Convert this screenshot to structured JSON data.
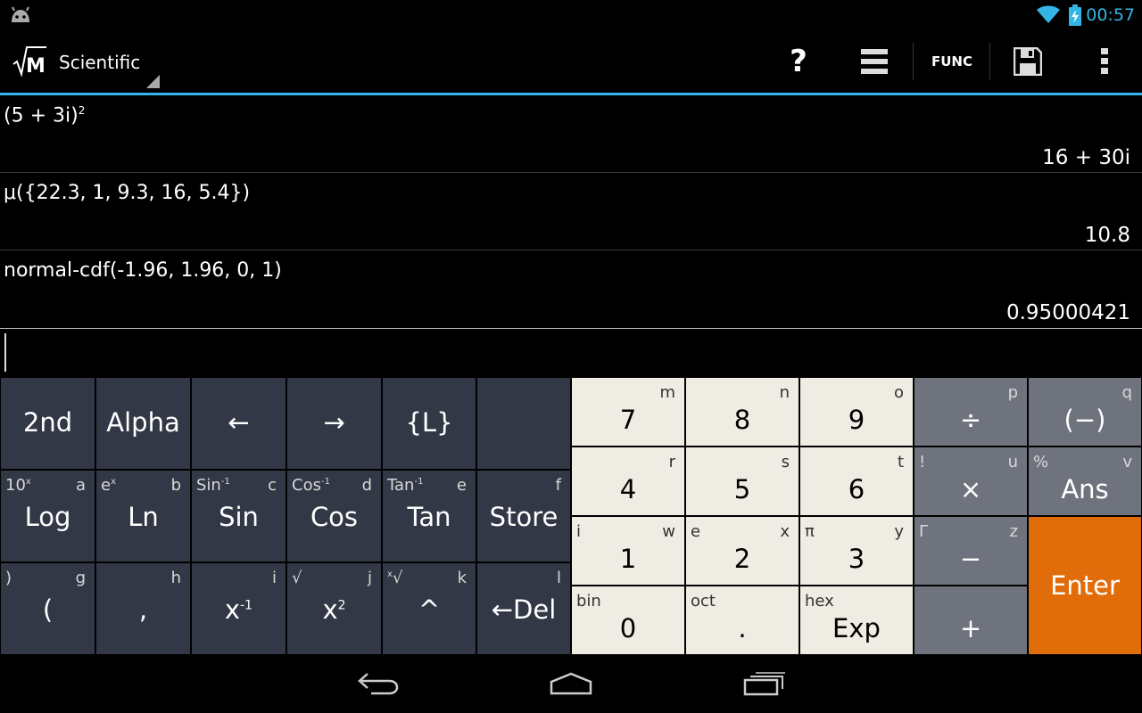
{
  "status_bar": {
    "time": "00:57",
    "icons": [
      "android-icon",
      "wifi-icon",
      "battery-charging-icon"
    ]
  },
  "action_bar": {
    "logo_text": "M",
    "mode": "Scientific",
    "func_label": "FUNC",
    "icons": [
      "help-icon",
      "history-list-icon",
      "save-icon",
      "overflow-menu-icon"
    ]
  },
  "history": [
    {
      "expr_base": "(5 + 3i)",
      "expr_sup": "2",
      "result": "16 + 30i"
    },
    {
      "expr_base": "μ({22.3, 1, 9.3, 16, 5.4})",
      "expr_sup": "",
      "result": "10.8"
    },
    {
      "expr_base": "normal-cdf(-1.96, 1.96, 0, 1)",
      "expr_sup": "",
      "result": "0.95000421"
    }
  ],
  "input": {
    "value": ""
  },
  "keypad": {
    "row1": [
      {
        "main": "2nd"
      },
      {
        "main": "Alpha"
      },
      {
        "main": "←"
      },
      {
        "main": "→"
      },
      {
        "main": "{L}"
      },
      {
        "main": ""
      }
    ],
    "row2": [
      {
        "main": "Log",
        "sec": "10",
        "sec_sup": "x",
        "alpha": "a"
      },
      {
        "main": "Ln",
        "sec": "e",
        "sec_sup": "x",
        "alpha": "b"
      },
      {
        "main": "Sin",
        "sec": "Sin",
        "sec_sup": "-1",
        "alpha": "c"
      },
      {
        "main": "Cos",
        "sec": "Cos",
        "sec_sup": "-1",
        "alpha": "d"
      },
      {
        "main": "Tan",
        "sec": "Tan",
        "sec_sup": "-1",
        "alpha": "e"
      },
      {
        "main": "Store",
        "sec": "",
        "alpha": "f"
      }
    ],
    "row3": [
      {
        "main": "(",
        "sec": ")",
        "alpha": "g"
      },
      {
        "main": ",",
        "sec": "",
        "alpha": "h"
      },
      {
        "main": "x",
        "main_sup": "-1",
        "sec": "",
        "alpha": "i"
      },
      {
        "main": "x",
        "main_sup": "2",
        "sec": "√",
        "alpha": "j"
      },
      {
        "main": "^",
        "sec_pre": "x",
        "sec": "√",
        "alpha": "k"
      },
      {
        "main": "←Del",
        "sec": "",
        "alpha": "l"
      }
    ],
    "numpad": [
      [
        {
          "main": "7",
          "alpha": "m"
        },
        {
          "main": "8",
          "alpha": "n"
        },
        {
          "main": "9",
          "alpha": "o"
        }
      ],
      [
        {
          "main": "4",
          "alpha": "r"
        },
        {
          "main": "5",
          "alpha": "s"
        },
        {
          "main": "6",
          "alpha": "t"
        }
      ],
      [
        {
          "main": "1",
          "sec": "i",
          "alpha": "w"
        },
        {
          "main": "2",
          "sec": "e",
          "alpha": "x"
        },
        {
          "main": "3",
          "sec": "π",
          "alpha": "y"
        }
      ],
      [
        {
          "main": "0",
          "sec": "bin"
        },
        {
          "main": ".",
          "sec": "oct"
        },
        {
          "main": "Exp",
          "sec": "hex"
        }
      ]
    ],
    "ops": {
      "divide": {
        "main": "÷",
        "alpha": "p"
      },
      "negate": {
        "main": "(−)",
        "alpha": "q"
      },
      "multiply": {
        "main": "×",
        "sec": "!",
        "alpha": "u"
      },
      "ans": {
        "main": "Ans",
        "sec": "%",
        "alpha": "v"
      },
      "minus": {
        "main": "−",
        "sec": "Γ",
        "alpha": "z"
      },
      "plus": {
        "main": "+"
      },
      "enter": {
        "main": "Enter"
      }
    }
  },
  "nav_bar": {
    "icons": [
      "back-icon",
      "home-icon",
      "recent-apps-icon"
    ]
  },
  "colors": {
    "accent": "#33b5e5",
    "dark_key": "#333846",
    "light_key": "#efece3",
    "op_key": "#6e737d",
    "enter_key": "#e06c0a"
  }
}
